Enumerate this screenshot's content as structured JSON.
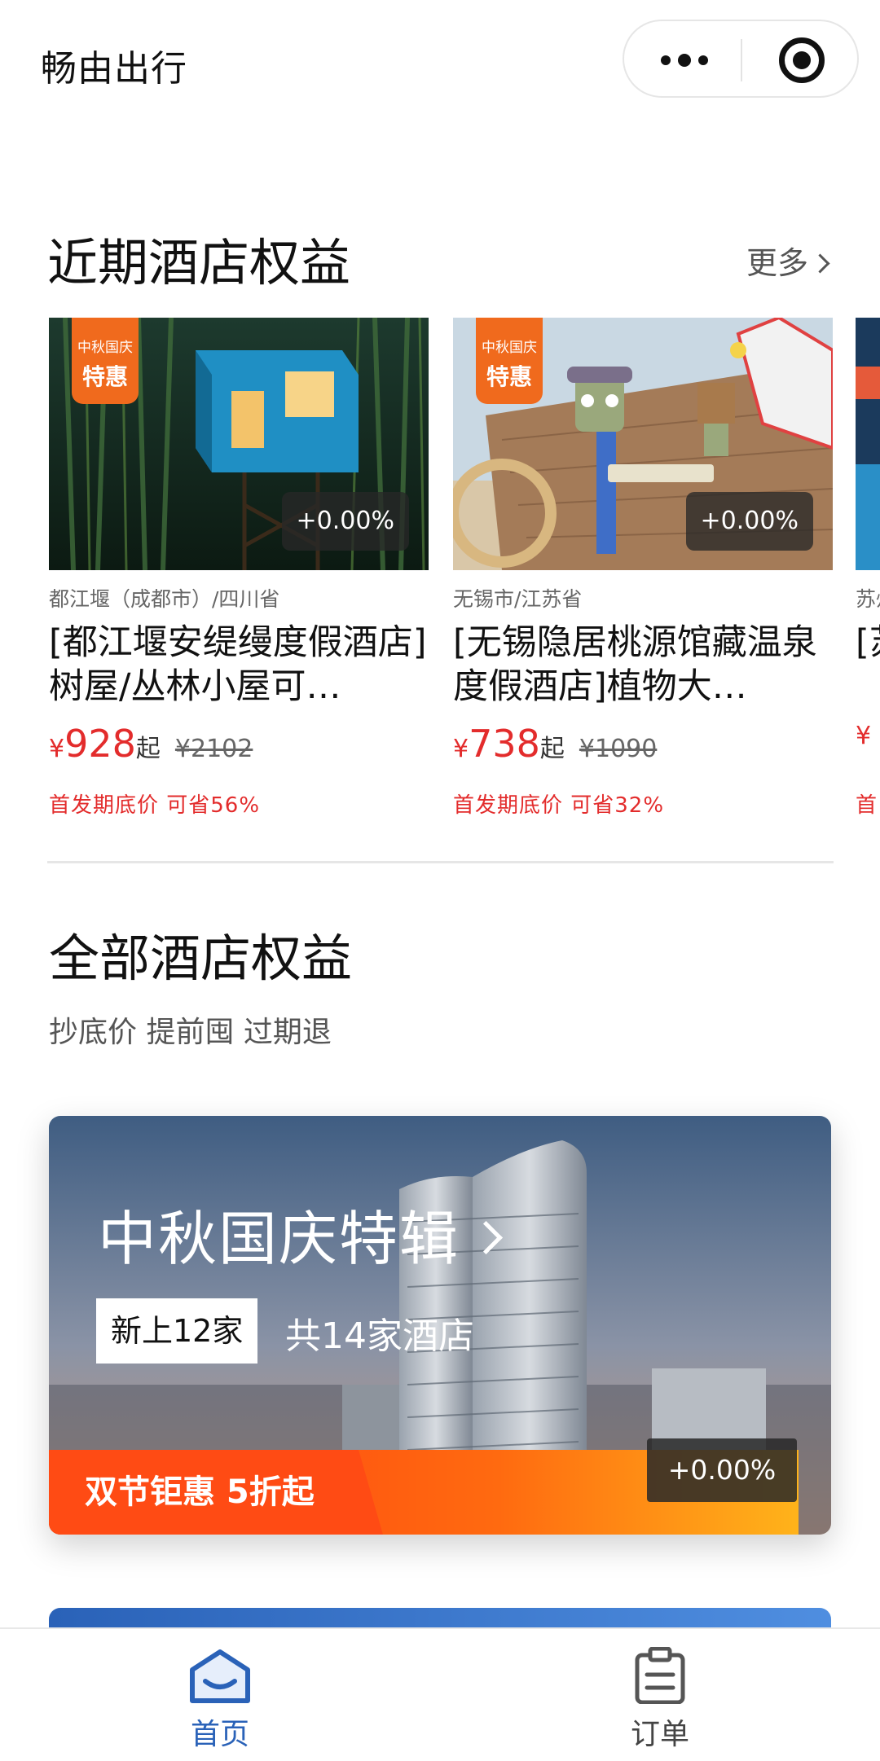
{
  "app": {
    "title": "畅由出行"
  },
  "capsule": {
    "more_icon": "more-dots-icon",
    "close_icon": "target-circle-icon"
  },
  "recent": {
    "title": "近期酒店权益",
    "more_label": "更多",
    "cards": [
      {
        "badge_line1": "中秋国庆",
        "badge_line2": "特惠",
        "rate": "+0.00%",
        "location": "都江堰（成都市）/四川省",
        "name": "[都江堰安缇缦度假酒店]树屋/丛林小屋可…",
        "yen": "¥",
        "price": "928",
        "price_suffix": "起",
        "original_price": "¥2102",
        "promo": "首发期底价 可省56%"
      },
      {
        "badge_line1": "中秋国庆",
        "badge_line2": "特惠",
        "rate": "+0.00%",
        "location": "无锡市/江苏省",
        "name": "[无锡隐居桃源馆藏温泉度假酒店]植物大…",
        "yen": "¥",
        "price": "738",
        "price_suffix": "起",
        "original_price": "¥1090",
        "promo": "首发期底价 可省32%"
      },
      {
        "location": "苏州市/江苏省",
        "name": "[苏",
        "yen": "¥",
        "promo": "首"
      }
    ]
  },
  "all": {
    "title": "全部酒店权益",
    "subtitle": "抄底价 提前囤 过期退",
    "banner": {
      "title": "中秋国庆特辑",
      "tag_new": "新上12家",
      "tag_total": "共14家酒店",
      "strip_label": "双节钜惠 5折起",
      "rate": "+0.00%"
    }
  },
  "tabs": [
    {
      "label": "首页",
      "icon": "home-icon",
      "active": true
    },
    {
      "label": "订单",
      "icon": "order-clipboard-icon",
      "active": false
    }
  ],
  "colors": {
    "accent_red": "#e32c2c",
    "tab_active": "#2a62b8",
    "badge_orange": "#f06a1d"
  }
}
